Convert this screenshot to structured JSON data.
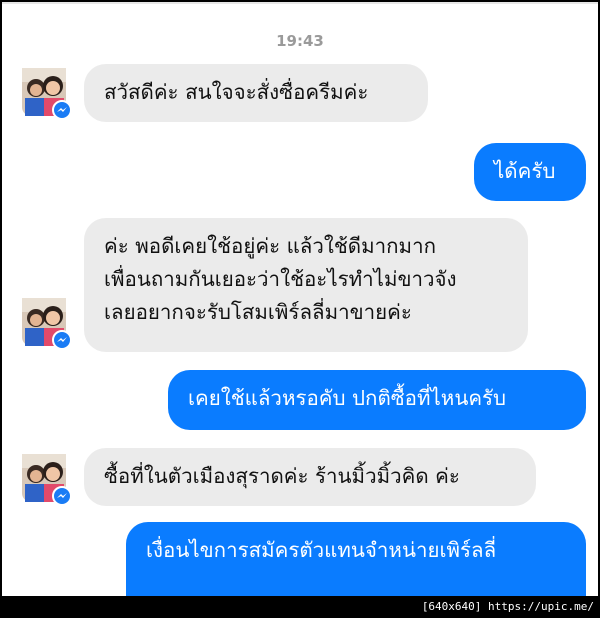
{
  "conversation": {
    "timestamp": "19:43",
    "messages": [
      {
        "from": "them",
        "lines": [
          "สวัสดีค่ะ สนใจจะสั่งซื่อครีมค่ะ"
        ]
      },
      {
        "from": "me",
        "lines": [
          "ได้ครับ"
        ]
      },
      {
        "from": "them",
        "lines": [
          "ค่ะ พอดีเคยใช้อยู่ค่ะ แล้วใช้ดีมากมาก",
          "เพื่อนถามกันเยอะว่าใช้อะไรทำไม่ขาวจัง",
          "เลยอยากจะรับโสมเพิร์ลลี่มาขายค่ะ"
        ]
      },
      {
        "from": "me",
        "lines": [
          "เคยใช้แล้วหรอคับ ปกติซื้อที่ไหนครับ"
        ]
      },
      {
        "from": "them",
        "lines": [
          "ซื้อที่ในตัวเมืองสุราดค่ะ ร้านมิ้วมิ้วคิด ค่ะ"
        ]
      },
      {
        "from": "me",
        "lines": [
          "เงื่อนไขการสมัครตัวแทนจำหน่ายเพิร์ลลี่"
        ]
      }
    ]
  },
  "avatar_icon": "contact-photo-with-messenger-badge",
  "colors": {
    "outgoing_bubble": "#0a7cff",
    "incoming_bubble": "#ebebeb",
    "timestamp": "#9a9a9a"
  },
  "watermark": "[640x640] https://upic.me/"
}
